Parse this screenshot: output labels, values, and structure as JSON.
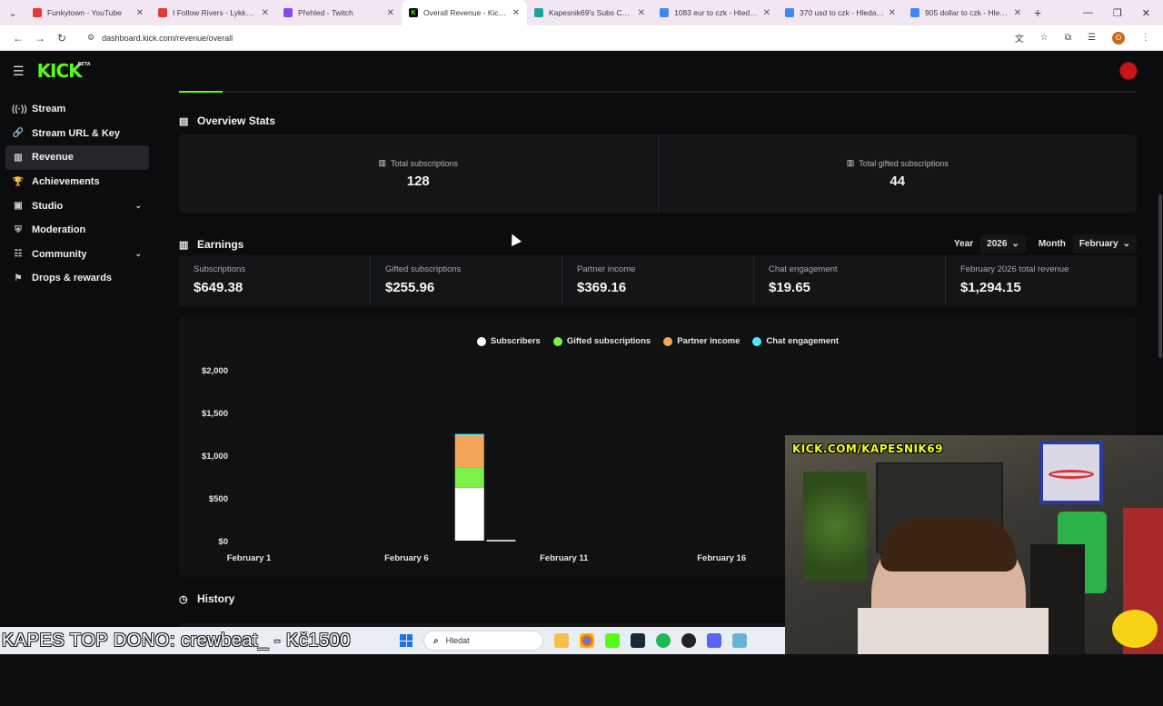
{
  "browser": {
    "tabs": [
      {
        "title": "Funkytown - YouTube",
        "favicon_color": "#e53935",
        "active": false
      },
      {
        "title": "I Follow Rivers - Lykke Li",
        "favicon_color": "#e53935",
        "active": false
      },
      {
        "title": "Přehled - Twitch",
        "favicon_color": "#8a45f0",
        "active": false
      },
      {
        "title": "Overall Revenue - Kick Da",
        "favicon_color": "#0b0c0d",
        "active": true
      },
      {
        "title": "Kapesnik69's Subs Count",
        "favicon_color": "#19a39a",
        "active": false
      },
      {
        "title": "1083 eur to czk - Hledat G",
        "favicon_color": "#4285f4",
        "active": false
      },
      {
        "title": "370 usd to czk - Hledat G",
        "favicon_color": "#4285f4",
        "active": false
      },
      {
        "title": "905 dollar to czk - Hledat",
        "favicon_color": "#4285f4",
        "active": false
      }
    ],
    "url": "dashboard.kick.com/revenue/overall",
    "profile_initial": "O"
  },
  "header": {
    "logo": "KICK",
    "logo_badge": "BETA"
  },
  "sidebar": {
    "items": [
      {
        "label": "Stream",
        "icon": "stream-icon",
        "glyph": "((·))",
        "expandable": false,
        "active": false
      },
      {
        "label": "Stream URL & Key",
        "icon": "link-icon",
        "glyph": "🔗",
        "expandable": false,
        "active": false
      },
      {
        "label": "Revenue",
        "icon": "chart-icon",
        "glyph": "▥",
        "expandable": false,
        "active": true
      },
      {
        "label": "Achievements",
        "icon": "trophy-icon",
        "glyph": "🏆",
        "expandable": false,
        "active": false
      },
      {
        "label": "Studio",
        "icon": "studio-icon",
        "glyph": "▣",
        "expandable": true,
        "active": false
      },
      {
        "label": "Moderation",
        "icon": "shield-icon",
        "glyph": "⛨",
        "expandable": false,
        "active": false
      },
      {
        "label": "Community",
        "icon": "community-icon",
        "glyph": "☷",
        "expandable": true,
        "active": false
      },
      {
        "label": "Drops & rewards",
        "icon": "drops-icon",
        "glyph": "⚑",
        "expandable": false,
        "active": false
      }
    ]
  },
  "overview": {
    "title": "Overview Stats",
    "stats": [
      {
        "label": "Total subscriptions",
        "value": "128"
      },
      {
        "label": "Total gifted subscriptions",
        "value": "44"
      }
    ]
  },
  "earnings": {
    "title": "Earnings",
    "year_label": "Year",
    "year_value": "2026",
    "month_label": "Month",
    "month_value": "February",
    "cells": [
      {
        "label": "Subscriptions",
        "value": "$649.38"
      },
      {
        "label": "Gifted subscriptions",
        "value": "$255.96"
      },
      {
        "label": "Partner income",
        "value": "$369.16"
      },
      {
        "label": "Chat engagement",
        "value": "$19.65"
      },
      {
        "label": "February 2026 total revenue",
        "value": "$1,294.15"
      }
    ]
  },
  "history": {
    "title": "History"
  },
  "colors": {
    "accent": "#53fc18",
    "subscribers": "#ffffff",
    "gifted": "#7ef04a",
    "partner": "#f2a65a",
    "chat": "#55e6f5"
  },
  "chart_data": {
    "type": "bar",
    "stacked": true,
    "x_tick_labels": [
      "February 1",
      "February 6",
      "February 11",
      "February 16"
    ],
    "y_tick_labels": [
      "$2,000",
      "$1,500",
      "$1,000",
      "$500",
      "$0"
    ],
    "ylim": [
      0,
      2000
    ],
    "categories": [
      "February 8",
      "February 9"
    ],
    "series": [
      {
        "name": "Subscribers",
        "color": "#ffffff",
        "values": [
          620,
          8
        ]
      },
      {
        "name": "Gifted subscriptions",
        "color": "#7ef04a",
        "values": [
          240,
          0
        ]
      },
      {
        "name": "Partner income",
        "color": "#f2a65a",
        "values": [
          369,
          0
        ]
      },
      {
        "name": "Chat engagement",
        "color": "#55e6f5",
        "values": [
          20,
          0
        ]
      }
    ]
  },
  "webcam": {
    "sign": "KICK.COM/KAPESNIK69"
  },
  "ticker": {
    "text": "KAPES TOP DONO: crewbeat_ - Kč1500"
  },
  "taskbar": {
    "search_placeholder": "Hledat"
  }
}
